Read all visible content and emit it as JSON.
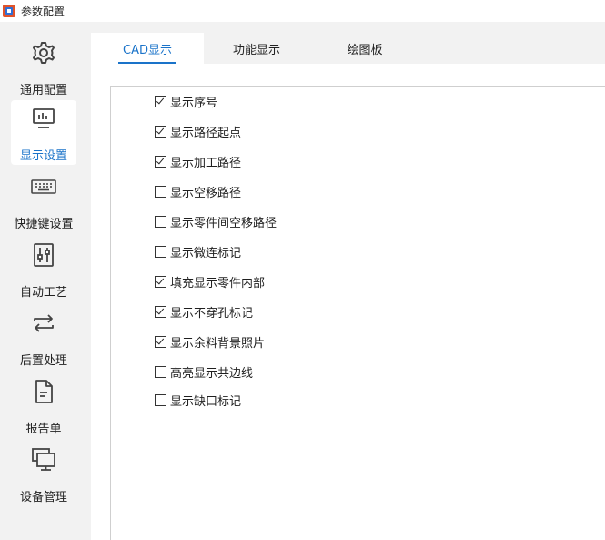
{
  "window": {
    "title": "参数配置"
  },
  "sidebar": {
    "items": [
      {
        "label": "通用配置",
        "icon": "gear-icon",
        "active": false
      },
      {
        "label": "显示设置",
        "icon": "monitor-chart-icon",
        "active": true
      },
      {
        "label": "快捷键设置",
        "icon": "keyboard-icon",
        "active": false
      },
      {
        "label": "自动工艺",
        "icon": "sliders-icon",
        "active": false
      },
      {
        "label": "后置处理",
        "icon": "repeat-arrows-icon",
        "active": false
      },
      {
        "label": "报告单",
        "icon": "document-icon",
        "active": false
      },
      {
        "label": "设备管理",
        "icon": "screens-icon",
        "active": false
      }
    ]
  },
  "tabs": [
    {
      "label": "CAD显示",
      "active": true
    },
    {
      "label": "功能显示",
      "active": false
    },
    {
      "label": "绘图板",
      "active": false
    }
  ],
  "options": [
    {
      "label": "显示序号",
      "checked": true
    },
    {
      "label": "显示路径起点",
      "checked": true
    },
    {
      "label": "显示加工路径",
      "checked": true
    },
    {
      "label": "显示空移路径",
      "checked": false
    },
    {
      "label": "显示零件间空移路径",
      "checked": false
    },
    {
      "label": "显示微连标记",
      "checked": false
    },
    {
      "label": "填充显示零件内部",
      "checked": true
    },
    {
      "label": "显示不穿孔标记",
      "checked": true
    },
    {
      "label": "显示余料背景照片",
      "checked": true
    },
    {
      "label": "高亮显示共边线",
      "checked": false
    },
    {
      "label": "显示缺口标记",
      "checked": false
    }
  ],
  "colors": {
    "accent": "#1a73c9",
    "sidebar_bg": "#f2f2f2"
  }
}
